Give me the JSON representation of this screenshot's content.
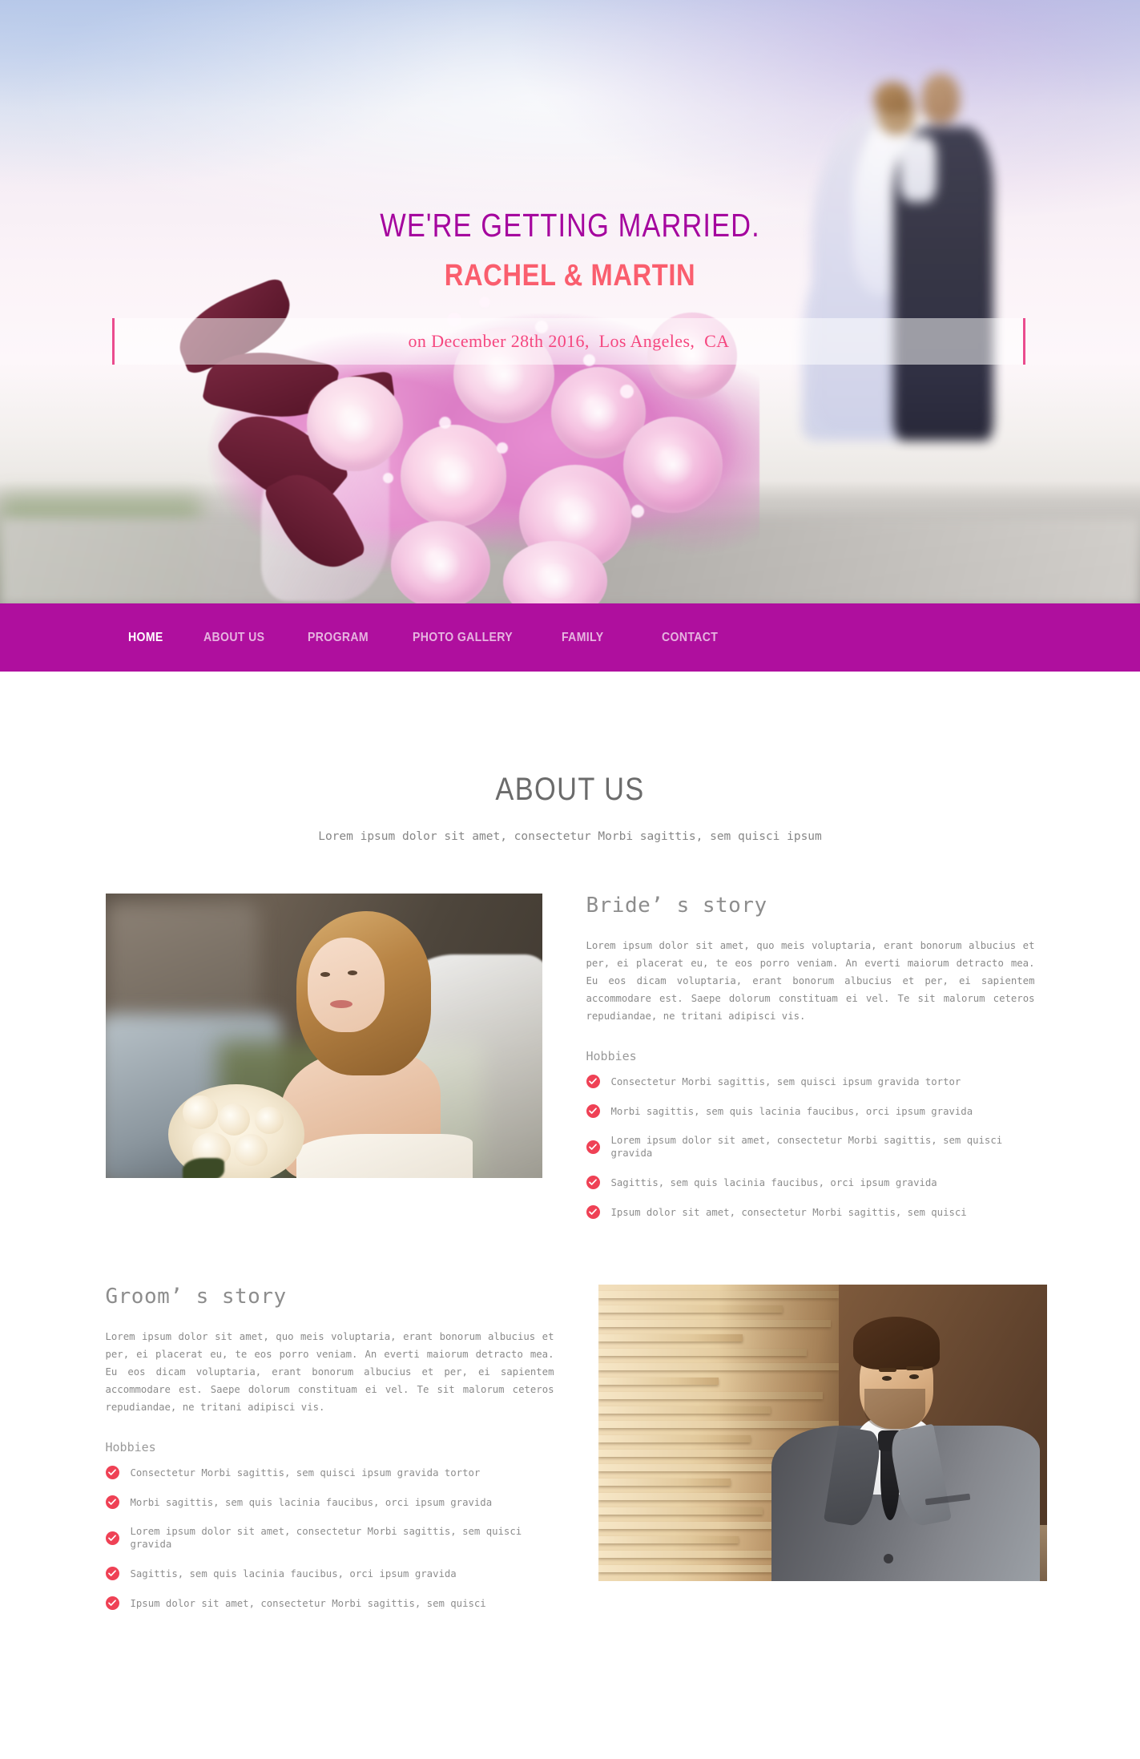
{
  "hero": {
    "title": "WE'RE GETTING MARRIED.",
    "couple_names": "RACHEL & MARTIN",
    "date_line": "on December 28th 2016,  Los Angeles,  CA",
    "colors": {
      "title": "#a5069e",
      "names": "#fa5e6e",
      "date": "#f5467f",
      "date_border": "#ea4c8e"
    }
  },
  "nav": {
    "background": "#af0f9e",
    "active_color": "#ffffff",
    "inactive_color": "#e6b4e0",
    "items": [
      {
        "label": "HOME",
        "active": true
      },
      {
        "label": "ABOUT US",
        "active": false
      },
      {
        "label": "PROGRAM",
        "active": false
      },
      {
        "label": "PHOTO GALLERY",
        "active": false
      },
      {
        "label": "FAMILY",
        "active": false
      },
      {
        "label": "CONTACT",
        "active": false
      }
    ]
  },
  "about": {
    "heading": "ABOUT US",
    "subheading": "Lorem ipsum dolor sit amet, consectetur Morbi sagittis, sem quisci ipsum",
    "bride": {
      "heading": "Bride’ s story",
      "paragraph": "Lorem ipsum dolor sit amet, quo meis voluptaria, erant bonorum albucius et per, ei placerat eu, te eos porro veniam. An everti maiorum detracto mea. Eu eos dicam voluptaria, erant bonorum albucius et per, ei sapientem accommodare est. Saepe dolorum constituam ei vel. Te sit malorum ceteros repudiandae, ne tritani adipisci vis.",
      "hobbies_heading": "Hobbies",
      "hobbies": [
        "Consectetur Morbi sagittis, sem quisci ipsum gravida tortor",
        "Morbi sagittis, sem quis lacinia faucibus, orci ipsum gravida",
        "Lorem ipsum dolor sit amet, consectetur Morbi sagittis, sem quisci gravida",
        "Sagittis, sem quis lacinia faucibus, orci ipsum gravida",
        "Ipsum dolor sit amet, consectetur Morbi sagittis, sem quisci"
      ],
      "photo_alt": "bride-portrait"
    },
    "groom": {
      "heading": "Groom’ s story",
      "paragraph": "Lorem ipsum dolor sit amet, quo meis voluptaria, erant bonorum albucius et per, ei placerat eu, te eos porro veniam. An everti maiorum detracto mea. Eu eos dicam voluptaria, erant bonorum albucius et per, ei sapientem accommodare est. Saepe dolorum constituam ei vel. Te sit malorum ceteros repudiandae, ne tritani adipisci vis.",
      "hobbies_heading": "Hobbies",
      "hobbies": [
        "Consectetur Morbi sagittis, sem quisci ipsum gravida tortor",
        "Morbi sagittis, sem quis lacinia faucibus, orci ipsum gravida",
        "Lorem ipsum dolor sit amet, consectetur Morbi sagittis, sem quisci gravida",
        "Sagittis, sem quis lacinia faucibus, orci ipsum gravida",
        "Ipsum dolor sit amet, consectetur Morbi sagittis, sem quisci"
      ],
      "photo_alt": "groom-portrait"
    },
    "check_icon_color": "#ef4155",
    "heading_color": "#6b6b6b"
  }
}
